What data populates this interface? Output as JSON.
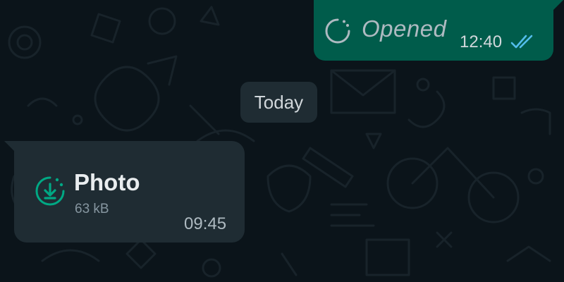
{
  "chat": {
    "outgoing_message": {
      "text": "Opened",
      "time": "12:40",
      "status": "read",
      "status_icon": "double-check-icon",
      "type_icon": "view-once-opened-icon",
      "status_color": "#53bdeb"
    },
    "date_separator": {
      "label": "Today"
    },
    "incoming_message": {
      "file_label": "Photo",
      "file_size": "63 kB",
      "time": "09:45",
      "download_icon": "view-once-download-icon",
      "accent_color": "#00a884"
    },
    "colors": {
      "background": "#0b141a",
      "outgoing_bubble": "#005c4b",
      "incoming_bubble": "#1f2c33"
    }
  }
}
